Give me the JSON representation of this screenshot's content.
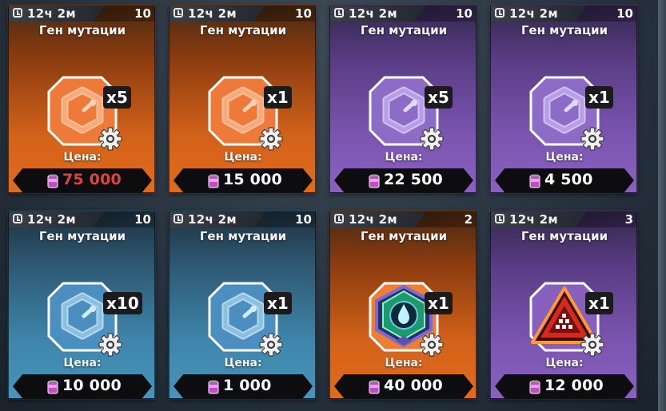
{
  "colors": {
    "orange": "#e06b1c",
    "purple": "#8a60c0",
    "blue": "#4794bb",
    "price_unaffordable": "#e0453a",
    "price_default": "#ffffff"
  },
  "shop": {
    "price_label": "Цена:",
    "items": [
      {
        "timer": "12ч 2м",
        "count": "10",
        "title": "Ген мутации",
        "qty": "x5",
        "price": "75 000",
        "price_red": true,
        "theme": "orange",
        "icon": "mutation-gene-icon"
      },
      {
        "timer": "12ч 2м",
        "count": "10",
        "title": "Ген мутации",
        "qty": "x1",
        "price": "15 000",
        "price_red": false,
        "theme": "orange",
        "icon": "mutation-gene-icon"
      },
      {
        "timer": "12ч 2м",
        "count": "10",
        "title": "Ген мутации",
        "qty": "x5",
        "price": "22 500",
        "price_red": false,
        "theme": "purple",
        "icon": "mutation-gene-icon"
      },
      {
        "timer": "12ч 2м",
        "count": "10",
        "title": "Ген мутации",
        "qty": "x1",
        "price": "4 500",
        "price_red": false,
        "theme": "purple",
        "icon": "mutation-gene-icon"
      },
      {
        "timer": "12ч 2м",
        "count": "10",
        "title": "Ген мутации",
        "qty": "x10",
        "price": "10 000",
        "price_red": false,
        "theme": "blue",
        "icon": "mutation-gene-icon"
      },
      {
        "timer": "12ч 2м",
        "count": "10",
        "title": "Ген мутации",
        "qty": "x1",
        "price": "1 000",
        "price_red": false,
        "theme": "blue",
        "icon": "mutation-gene-icon"
      },
      {
        "timer": "12ч 2м",
        "count": "2",
        "title": "Ген мутации",
        "qty": "x1",
        "price": "40 000",
        "price_red": false,
        "theme": "orange",
        "icon": "water-drop-badge-icon"
      },
      {
        "timer": "12ч 2м",
        "count": "3",
        "title": "Ген мутации",
        "qty": "x1",
        "price": "12 000",
        "price_red": false,
        "theme": "purple",
        "icon": "red-triangle-badge-icon"
      }
    ]
  }
}
